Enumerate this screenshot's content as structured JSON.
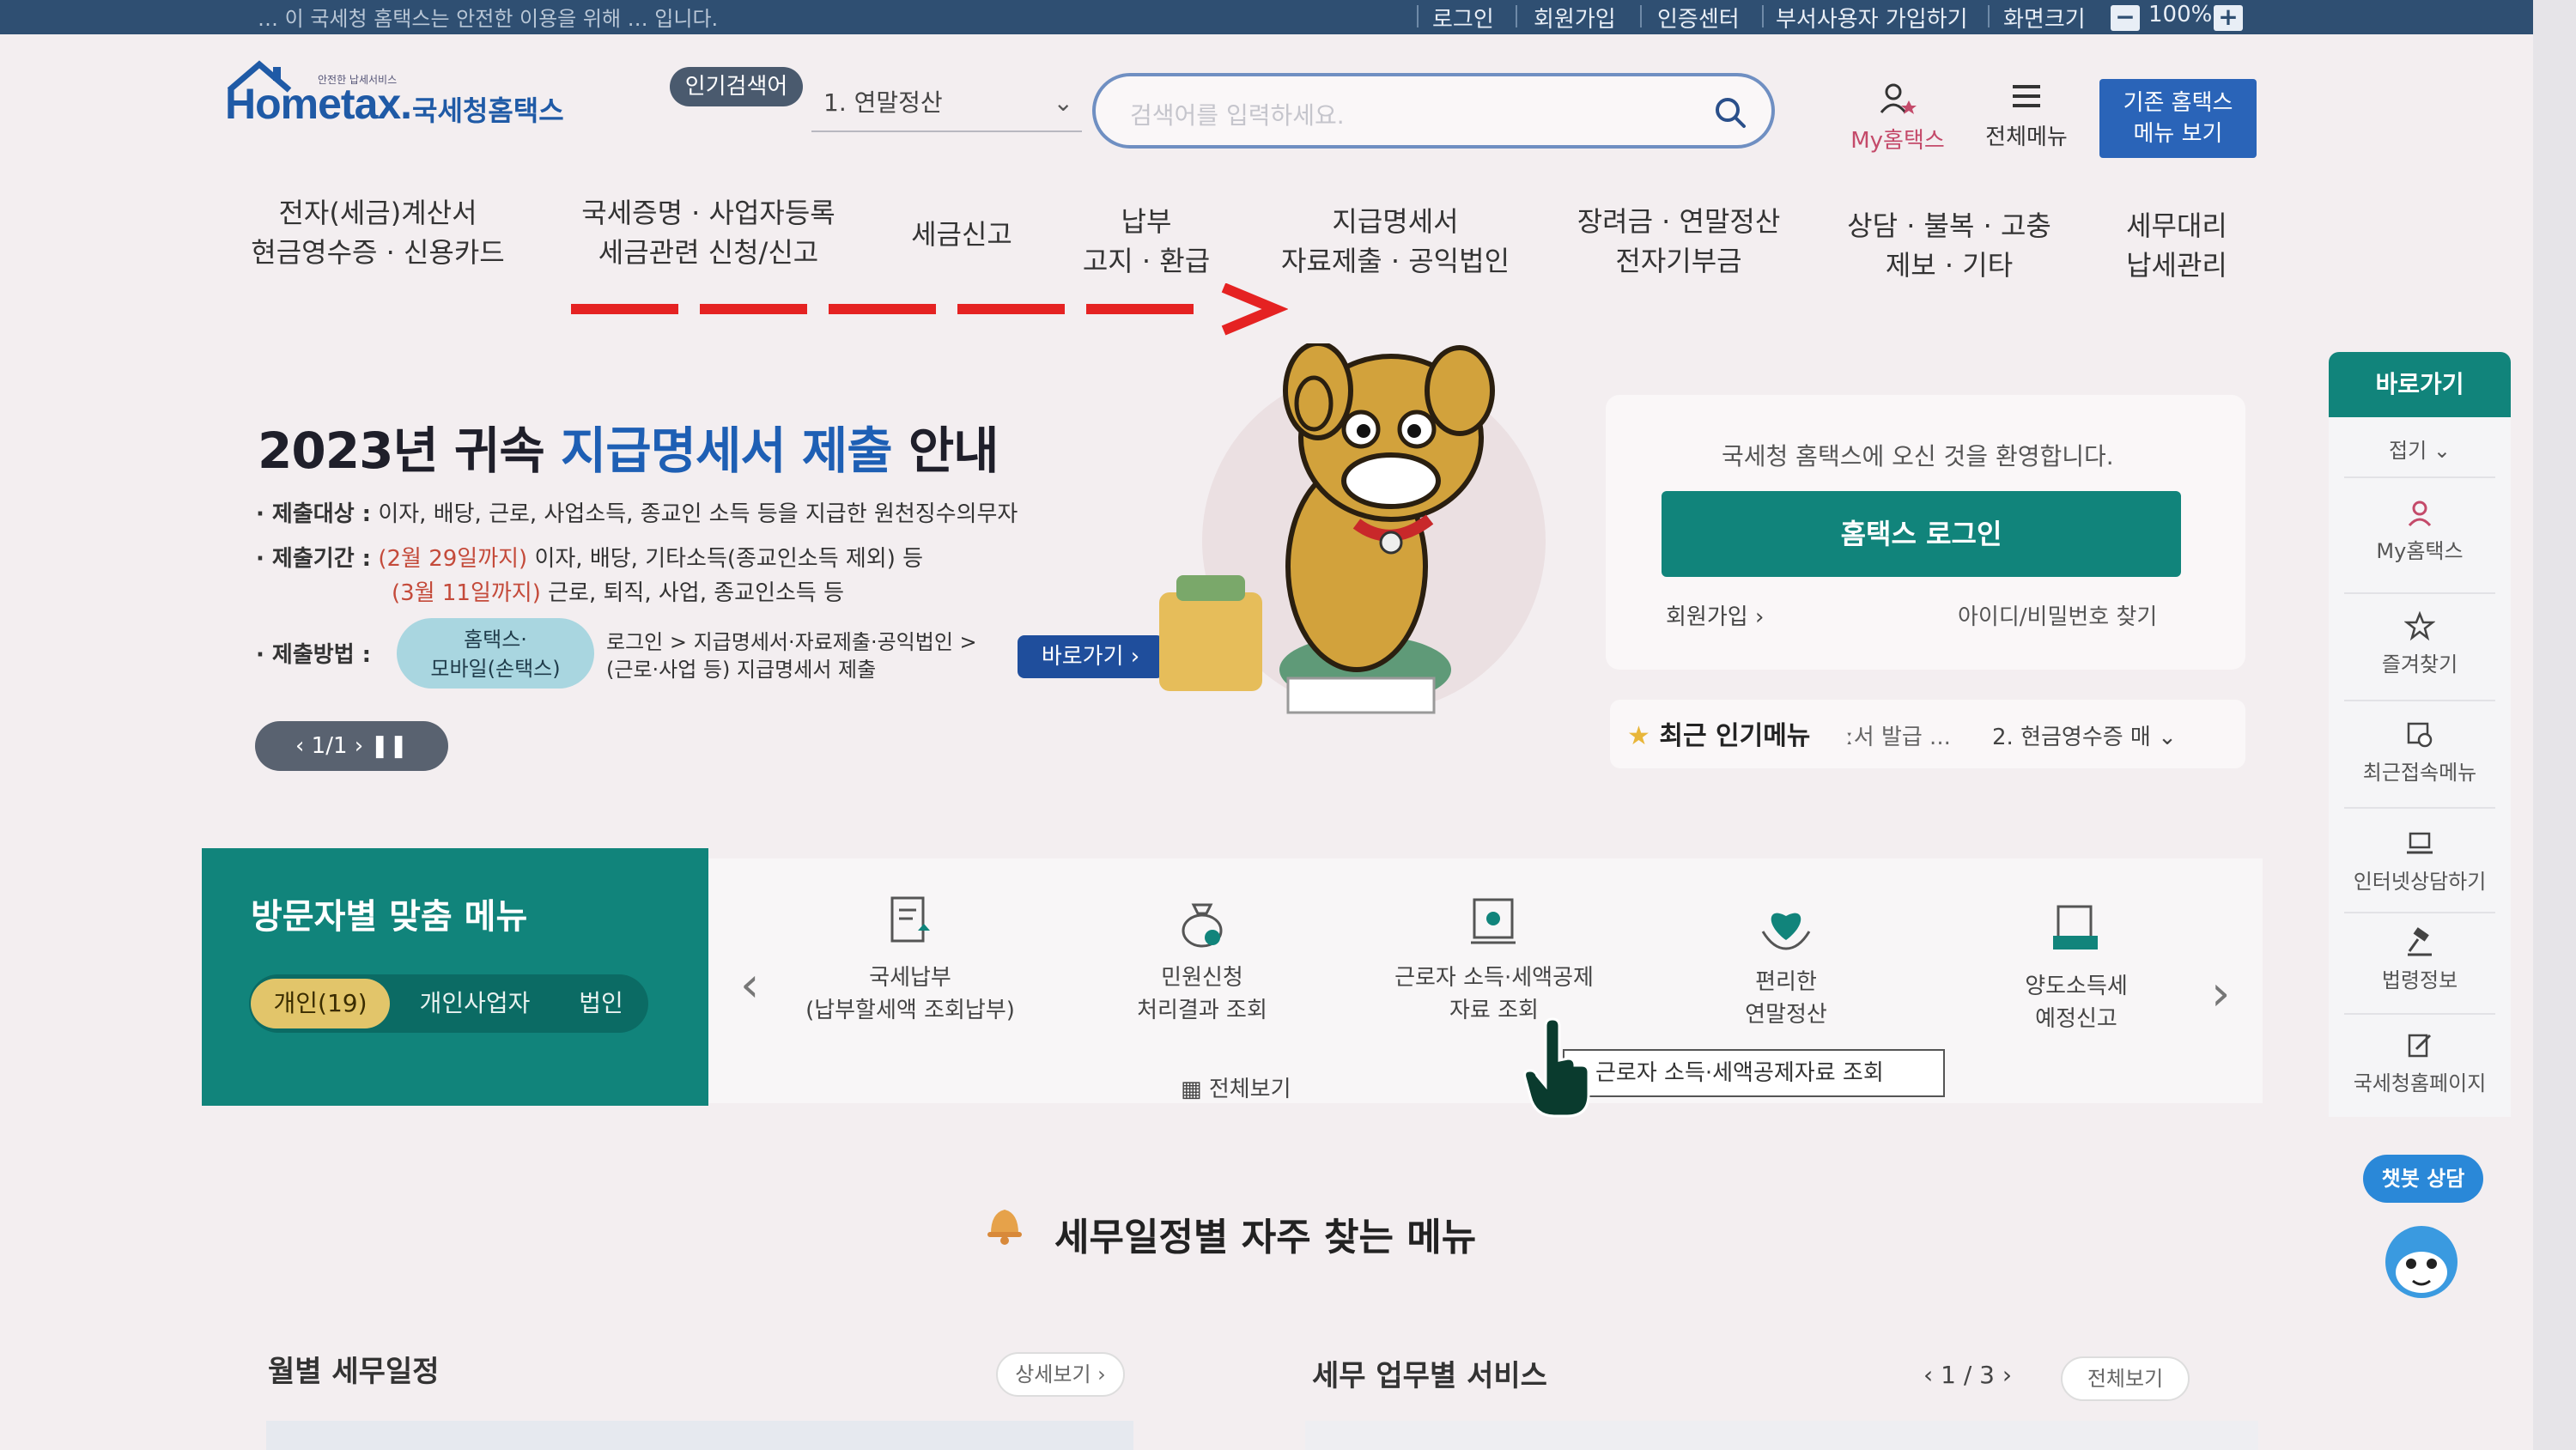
{
  "topbar": {
    "notice": "… 이 국세청 홈택스는 안전한 이용을 위해 … 입니다.",
    "links": [
      "로그인",
      "회원가입",
      "인증센터",
      "부서사용자 가입하기",
      "화면크기"
    ],
    "zoom": "100%",
    "zoom_minus": "−",
    "zoom_plus": "+"
  },
  "header": {
    "logo_text": "Hometax.",
    "logo_small": "안전한 납세서비스",
    "logo_kr": "국세청홈택스",
    "popular_badge": "인기검색어",
    "popular_selected": "1.  연말정산",
    "search_placeholder": "검색어를 입력하세요.",
    "my_hometax": "My홈택스",
    "all_menu": "전체메뉴",
    "classic_btn_line1": "기존 홈택스",
    "classic_btn_line2": "메뉴 보기"
  },
  "nav": [
    {
      "l1": "전자(세금)계산서",
      "l2": "현금영수증 · 신용카드"
    },
    {
      "l1": "국세증명 · 사업자등록",
      "l2": "세금관련 신청/신고"
    },
    {
      "l1": "세금신고",
      "l2": ""
    },
    {
      "l1": "납부",
      "l2": "고지 · 환급"
    },
    {
      "l1": "지급명세서",
      "l2": "자료제출 · 공익법인"
    },
    {
      "l1": "장려금 · 연말정산",
      "l2": "전자기부금"
    },
    {
      "l1": "상담 · 불복 · 고충",
      "l2": "제보 · 기타"
    },
    {
      "l1": "세무대리",
      "l2": "납세관리"
    }
  ],
  "hero": {
    "title_a": "2023년 귀속 ",
    "title_b": "지급명세서 제출",
    "title_c": " 안내",
    "target_key": "· 제출대상 :",
    "target_val": "이자, 배당, 근로, 사업소득, 종교인 소득 등을 지급한 원천징수의무자",
    "period_key": "· 제출기간 :",
    "period1_red": "(2월 29일까지)",
    "period1_rest": " 이자, 배당, 기타소득(종교인소득 제외) 등",
    "period2_red": "(3월 11일까지)",
    "period2_rest": " 근로, 퇴직, 사업, 종교인소득 등",
    "method_key": "· 제출방법 :",
    "method_pill_1": "홈택스·",
    "method_pill_2": "모바일(손택스)",
    "method_desc_1": "로그인 > 지급명세서·자료제출·공익법인 >",
    "method_desc_2": "(근로·사업 등) 지급명세서 제출",
    "goto": "바로가기  ›",
    "pager": "‹  1/1  ›    ❚❚"
  },
  "login": {
    "welcome": "국세청 홈택스에 오신 것을 환영합니다.",
    "login_btn": "홈택스 로그인",
    "join": "회원가입  ›",
    "find": "아이디/비밀번호 찾기",
    "recent_label": "최근 인기메뉴",
    "recent_item1": "ː서 발급 ...",
    "recent_item2": "2.  현금영수증 매  ⌄"
  },
  "quick_menu": {
    "title": "바로가기",
    "fold": "접기 ⌄",
    "items": [
      "My홈택스",
      "즐겨찾기",
      "최근접속메뉴",
      "인터넷상담하기",
      "법령정보",
      "국세청홈페이지"
    ],
    "chatbot": "챗봇 상담"
  },
  "visitor": {
    "title": "방문자별 맞춤 메뉴",
    "tabs": [
      "개인(19)",
      "개인사업자",
      "법인"
    ],
    "services": [
      {
        "l1": "국세납부",
        "l2": "(납부할세액 조회납부)"
      },
      {
        "l1": "민원신청",
        "l2": "처리결과 조회"
      },
      {
        "l1": "근로자 소득·세액공제",
        "l2": "자료 조회"
      },
      {
        "l1": "편리한",
        "l2": "연말정산"
      },
      {
        "l1": "양도소득세",
        "l2": "예정신고"
      }
    ],
    "view_all": "전체보기",
    "tooltip": "근로자 소득·세액공제자료 조회",
    "prev": "‹",
    "next": "›"
  },
  "schedule": {
    "title": "세무일정별 자주 찾는 메뉴",
    "monthly": "월별 세무일정",
    "detail": "상세보기  ›",
    "biz_service": "세무 업무별 서비스",
    "biz_pager": "‹   1 / 3   ›",
    "biz_all": "전체보기"
  },
  "colors": {
    "teal": "#11847b",
    "brand_blue": "#1f5aa6",
    "topbar": "#2f4f72",
    "highlight_red": "#c44a3a",
    "annotation_red": "#e52222"
  }
}
